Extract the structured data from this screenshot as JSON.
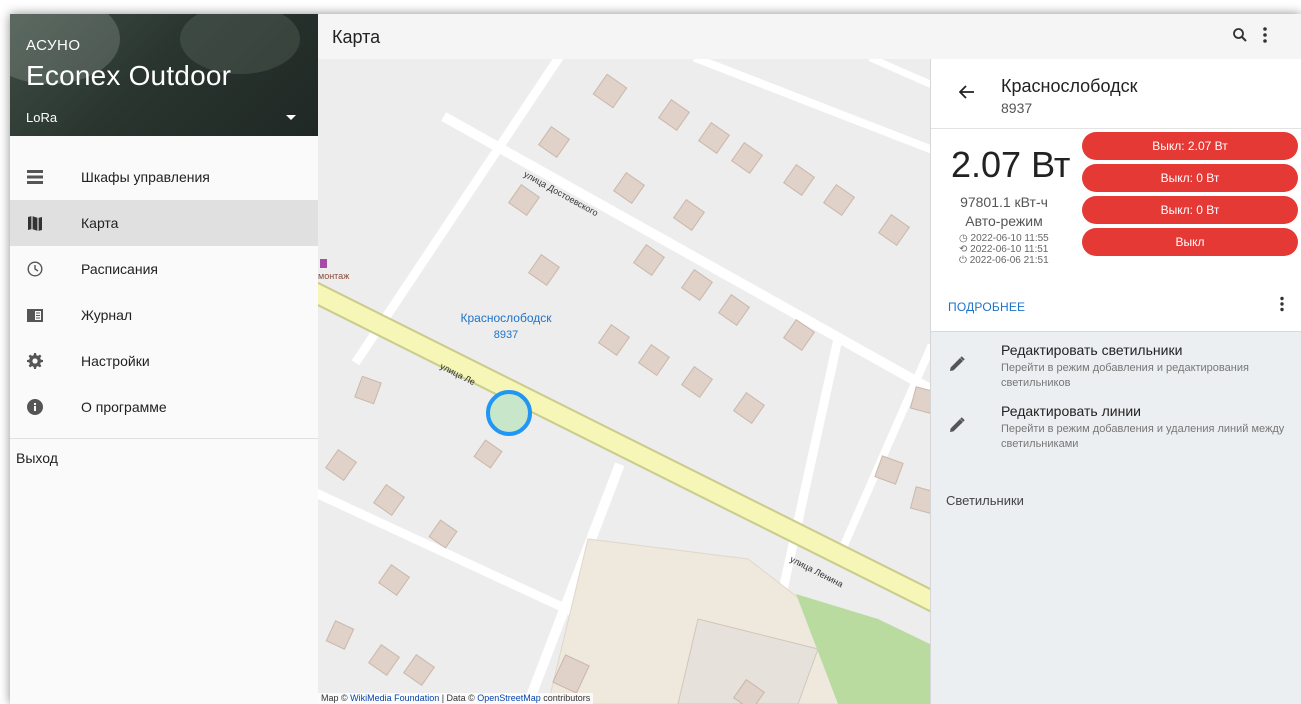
{
  "sidebar": {
    "brand_small": "АСУНО",
    "brand_big": "Econex Outdoor",
    "network": "LoRa",
    "items": [
      {
        "label": "Шкафы управления",
        "icon": "list-icon"
      },
      {
        "label": "Карта",
        "icon": "map-icon"
      },
      {
        "label": "Расписания",
        "icon": "clock-icon"
      },
      {
        "label": "Журнал",
        "icon": "journal-icon"
      },
      {
        "label": "Настройки",
        "icon": "gear-icon"
      },
      {
        "label": "О программе",
        "icon": "info-icon"
      }
    ],
    "active_index": 1,
    "logout": "Выход"
  },
  "topbar": {
    "title": "Карта"
  },
  "map": {
    "place_name": "Краснослободск",
    "place_id": "8937",
    "street_1": "улица Достоевского",
    "street_2a": "улица Ле",
    "street_2b": "улица Ленина",
    "poi": "монтаж",
    "attribution_prefix": "Map ©",
    "attribution_link1": "WikiMedia Foundation",
    "attribution_mid": "| Data ©",
    "attribution_link2": "OpenStreetMap",
    "attribution_suffix": "contributors"
  },
  "panel": {
    "name": "Краснослободск",
    "id": "8937",
    "power": "2.07 Вт",
    "energy": "97801.1 кВт-ч",
    "mode": "Авто-режим",
    "timestamps": [
      "◷ 2022-06-10 11:55",
      "⟲ 2022-06-10 11:51",
      "⏻ 2022-06-06 21:51"
    ],
    "buttons": [
      "Выкл: 2.07 Вт",
      "Выкл: 0 Вт",
      "Выкл: 0 Вт",
      "Выкл"
    ],
    "details_link": "ПОДРОБНЕЕ",
    "actions": [
      {
        "title": "Редактировать светильники",
        "desc": "Перейти в режим добавления и редактирования светильников"
      },
      {
        "title": "Редактировать линии",
        "desc": "Перейти в режим добавления и удаления линий между светильниками"
      }
    ],
    "section": "Светильники"
  },
  "colors": {
    "accent_red": "#e53935",
    "link_blue": "#1e73c8",
    "road_yellow": "#f6f7b6",
    "marker_fill": "#c8e6c9",
    "marker_stroke": "#2196f3"
  }
}
